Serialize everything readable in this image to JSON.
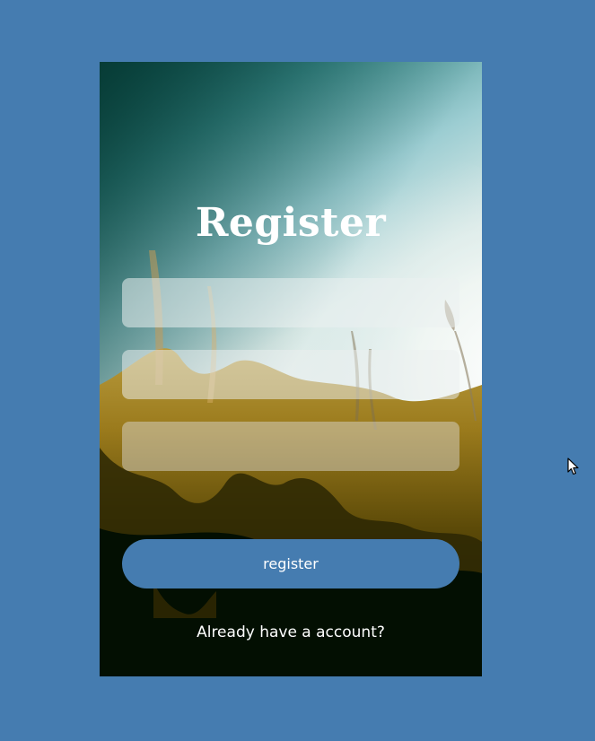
{
  "page": {
    "background_color": "#457cb0"
  },
  "card": {
    "background_image": "blurred-grass-meadow-sunlit-sky"
  },
  "register_form": {
    "title": "Register",
    "fields": [
      {
        "placeholder": "",
        "value": ""
      },
      {
        "placeholder": "",
        "value": ""
      },
      {
        "placeholder": "",
        "value": ""
      }
    ],
    "submit_label": "register",
    "submit_color": "#457cb0",
    "login_link_text": "Already have a account?"
  },
  "cursor": {
    "icon": "mouse-pointer-icon"
  }
}
